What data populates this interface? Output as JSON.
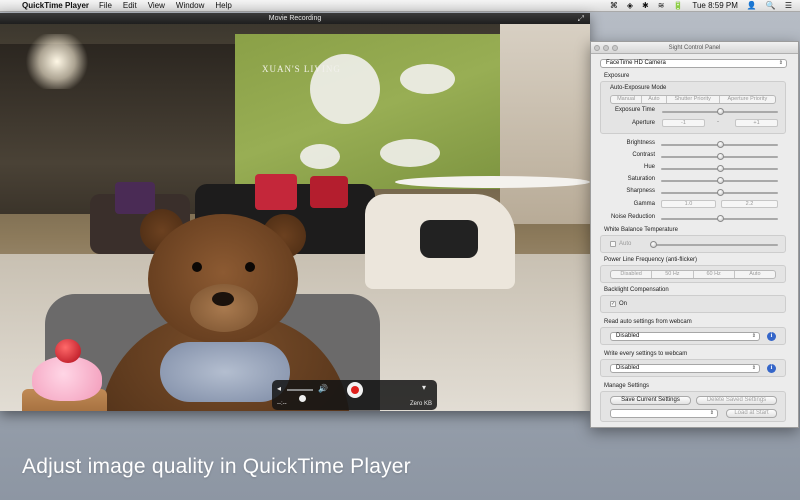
{
  "menubar": {
    "app_name": "QuickTime Player",
    "menus": [
      "File",
      "Edit",
      "View",
      "Window",
      "Help"
    ],
    "clock": "Tue 8:59 PM"
  },
  "movie_window": {
    "title": "Movie Recording",
    "store_sign": "XUAN'S LIVING",
    "hud": {
      "elapsed": "--:--",
      "file_size": "Zero KB"
    }
  },
  "panel": {
    "title": "Sight Control Panel",
    "camera": "FaceTime HD Camera",
    "exposure": {
      "label": "Exposure",
      "auto_mode_label": "Auto-Exposure Mode",
      "modes": [
        "Manual",
        "Auto",
        "Shutter Priority",
        "Aperture Priority"
      ],
      "exposure_time_label": "Exposure Time",
      "exposure_time_level": 0.5,
      "aperture_label": "Aperture",
      "aperture_minus": "-1",
      "aperture_dash": "-",
      "aperture_plus": "+1"
    },
    "adjustments": [
      {
        "label": "Brightness",
        "level": 0.5
      },
      {
        "label": "Contrast",
        "level": 0.5
      },
      {
        "label": "Hue",
        "level": 0.5
      },
      {
        "label": "Saturation",
        "level": 0.5
      },
      {
        "label": "Sharpness",
        "level": 0.5
      }
    ],
    "gamma": {
      "label": "Gamma",
      "value1": "1.0",
      "value2": "2.2"
    },
    "noise_reduction": {
      "label": "Noise Reduction",
      "level": 0.5
    },
    "white_balance": {
      "label": "White Balance Temperature",
      "auto_label": "Auto",
      "auto_checked": false,
      "level": 0.0
    },
    "power_line": {
      "label": "Power Line Frequency (anti-flicker)",
      "options": [
        "Disabled",
        "50 Hz",
        "60 Hz",
        "Auto"
      ]
    },
    "backlight": {
      "label": "Backlight Compensation",
      "on_label": "On",
      "checked": true,
      "check_glyph": "✓"
    },
    "read_auto": {
      "label": "Read auto settings from webcam",
      "value": "Disabled"
    },
    "write_every": {
      "label": "Write every settings to webcam",
      "value": "Disabled"
    },
    "manage": {
      "label": "Manage Settings",
      "save_current": "Save Current Settings",
      "delete_saved": "Delete Saved Settings",
      "preset_value": "",
      "load_at_start": "Load at Start"
    },
    "info_glyph": "i"
  },
  "caption": "Adjust image quality in QuickTime Player",
  "colors": {
    "accent_blue": "#3566c9",
    "record_red": "#e0201c"
  },
  "icons": {
    "apple": "",
    "fullscreen": "⤢",
    "volume_low": "◂",
    "volume_high": "🔊",
    "options": "▾",
    "select_arrow": "⇕",
    "menubar_status": [
      "⌘",
      "◈",
      "✱",
      "≋",
      "🔋"
    ],
    "user": "👤",
    "search": "🔍",
    "list": "☰"
  }
}
